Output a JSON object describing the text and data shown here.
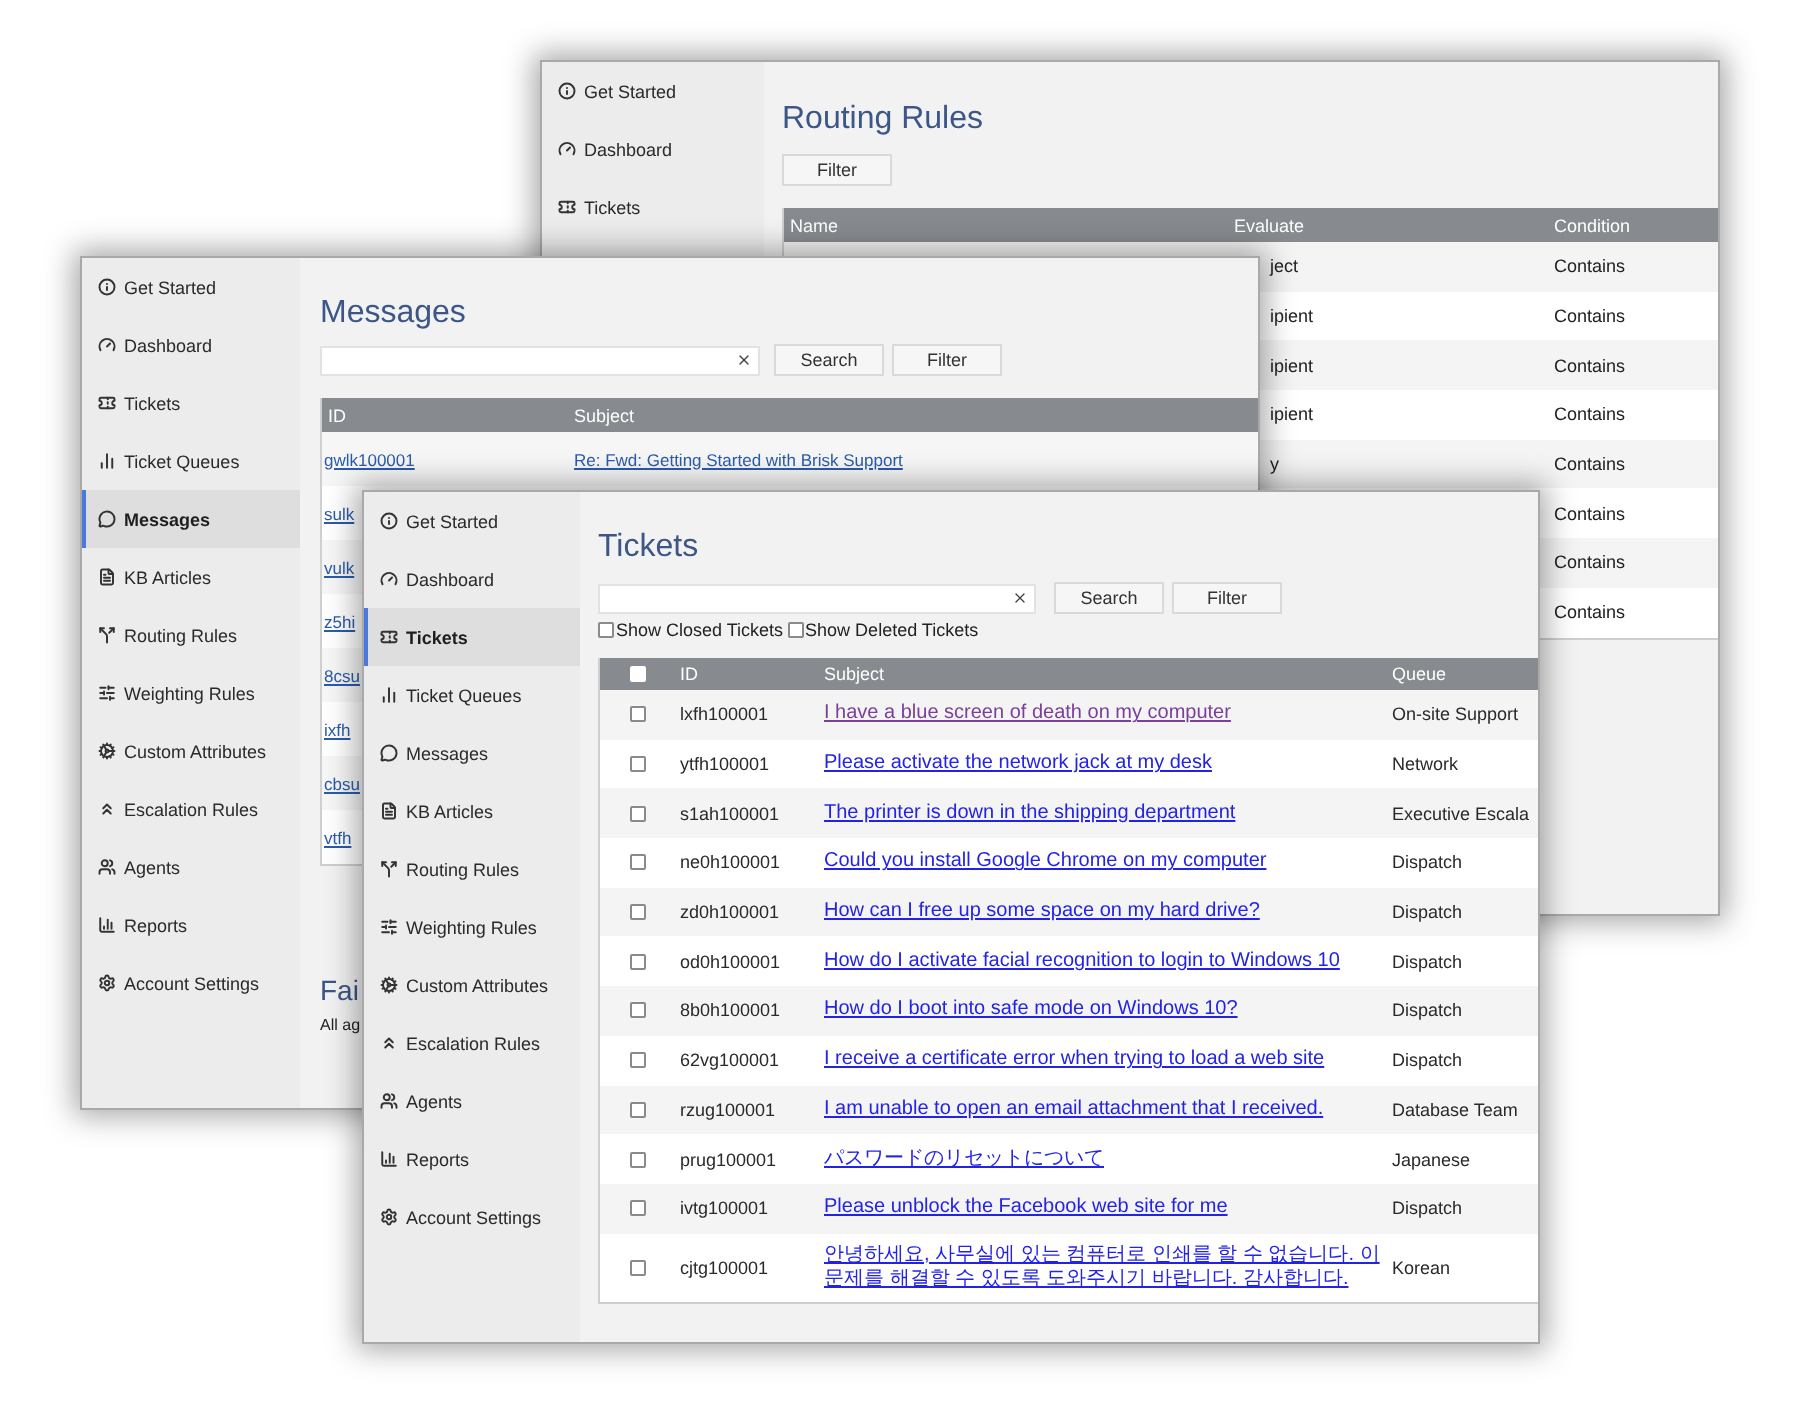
{
  "routing_rules_window": {
    "sidebar": {
      "items": [
        {
          "label": "Get Started",
          "selected": false
        },
        {
          "label": "Dashboard",
          "selected": false
        },
        {
          "label": "Tickets",
          "selected": false
        }
      ]
    },
    "title": "Routing Rules",
    "buttons": [
      "Filter"
    ],
    "table": {
      "columns": [
        "Name",
        "Evaluate",
        "Condition"
      ],
      "rows": [
        {
          "evaluate": "ject",
          "condition": "Contains"
        },
        {
          "evaluate": "ipient",
          "condition": "Contains"
        },
        {
          "evaluate": "ipient",
          "condition": "Contains"
        },
        {
          "evaluate": "ipient",
          "condition": "Contains"
        },
        {
          "evaluate": "y",
          "condition": "Contains"
        },
        {
          "condition": "Contains"
        },
        {
          "condition": "Contains"
        },
        {
          "condition": "Contains"
        }
      ]
    }
  },
  "messages_window": {
    "sidebar": {
      "items": [
        {
          "label": "Get Started",
          "selected": false
        },
        {
          "label": "Dashboard",
          "selected": false
        },
        {
          "label": "Tickets",
          "selected": false
        },
        {
          "label": "Ticket Queues",
          "selected": false
        },
        {
          "label": "Messages",
          "selected": true
        },
        {
          "label": "KB Articles",
          "selected": false
        },
        {
          "label": "Routing Rules",
          "selected": false
        },
        {
          "label": "Weighting Rules",
          "selected": false
        },
        {
          "label": "Custom Attributes",
          "selected": false
        },
        {
          "label": "Escalation Rules",
          "selected": false
        },
        {
          "label": "Agents",
          "selected": false
        },
        {
          "label": "Reports",
          "selected": false
        },
        {
          "label": "Account Settings",
          "selected": false
        }
      ]
    },
    "title": "Messages",
    "buttons": [
      "Search",
      "Filter"
    ],
    "table": {
      "columns": [
        "ID",
        "Subject"
      ],
      "rows": [
        {
          "id": "gwlk100001",
          "subject": "Re: Fwd: Getting Started with Brisk Support"
        },
        {
          "id": "sulk"
        },
        {
          "id": "vulk"
        },
        {
          "id": "z5hi"
        },
        {
          "id": "8csu"
        },
        {
          "id": "ixfh"
        },
        {
          "id": "cbsu"
        },
        {
          "id": "vtfh"
        }
      ]
    },
    "section": {
      "title": "Fai",
      "text": "All ag"
    }
  },
  "tickets_window": {
    "sidebar": {
      "items": [
        {
          "label": "Get Started",
          "selected": false
        },
        {
          "label": "Dashboard",
          "selected": false
        },
        {
          "label": "Tickets",
          "selected": true
        },
        {
          "label": "Ticket Queues",
          "selected": false
        },
        {
          "label": "Messages",
          "selected": false
        },
        {
          "label": "KB Articles",
          "selected": false
        },
        {
          "label": "Routing Rules",
          "selected": false
        },
        {
          "label": "Weighting Rules",
          "selected": false
        },
        {
          "label": "Custom Attributes",
          "selected": false
        },
        {
          "label": "Escalation Rules",
          "selected": false
        },
        {
          "label": "Agents",
          "selected": false
        },
        {
          "label": "Reports",
          "selected": false
        },
        {
          "label": "Account Settings",
          "selected": false
        }
      ]
    },
    "title": "Tickets",
    "buttons": [
      "Search",
      "Filter"
    ],
    "filters": [
      {
        "label": "Show Closed Tickets",
        "checked": false
      },
      {
        "label": "Show Deleted Tickets",
        "checked": false
      }
    ],
    "table": {
      "select_all": {
        "checked": false
      },
      "columns": [
        "ID",
        "Subject",
        "Queue"
      ],
      "rows": [
        {
          "checked": false,
          "id": "lxfh100001",
          "subject": "I have a blue screen of death on my computer",
          "visited": true,
          "queue": "On-site Support"
        },
        {
          "checked": false,
          "id": "ytfh100001",
          "subject": "Please activate the network jack at my desk",
          "visited": false,
          "queue": "Network"
        },
        {
          "checked": false,
          "id": "s1ah100001",
          "subject": "The printer is down in the shipping department",
          "visited": false,
          "queue": "Executive Escala"
        },
        {
          "checked": false,
          "id": "ne0h100001",
          "subject": "Could you install Google Chrome on my computer",
          "visited": false,
          "queue": "Dispatch"
        },
        {
          "checked": false,
          "id": "zd0h100001",
          "subject": "How can I free up some space on my hard drive?",
          "visited": false,
          "queue": "Dispatch"
        },
        {
          "checked": false,
          "id": "od0h100001",
          "subject": "How do I activate facial recognition to login to Windows 10",
          "visited": false,
          "queue": "Dispatch"
        },
        {
          "checked": false,
          "id": "8b0h100001",
          "subject": "How do I boot into safe mode on Windows 10?",
          "visited": false,
          "queue": "Dispatch"
        },
        {
          "checked": false,
          "id": "62vg100001",
          "subject": "I receive a certificate error when trying to load a web site",
          "visited": false,
          "queue": "Dispatch"
        },
        {
          "checked": false,
          "id": "rzug100001",
          "subject": "I am unable to open an email attachment that I received.",
          "visited": false,
          "queue": "Database Team"
        },
        {
          "checked": false,
          "id": "prug100001",
          "subject": "パスワードのリセットについて",
          "visited": false,
          "queue": "Japanese"
        },
        {
          "checked": false,
          "id": "ivtg100001",
          "subject": "Please unblock the Facebook web site for me",
          "visited": false,
          "queue": "Dispatch"
        },
        {
          "checked": false,
          "id": "cjtg100001",
          "subject": "안녕하세요, 사무실에 있는 컴퓨터로 인쇄를 할 수 없습니다. 이 문제를 해결할 수 있도록 도와주시기 바랍니다. 감사합니다.",
          "visited": false,
          "queue": "Korean"
        }
      ]
    }
  }
}
